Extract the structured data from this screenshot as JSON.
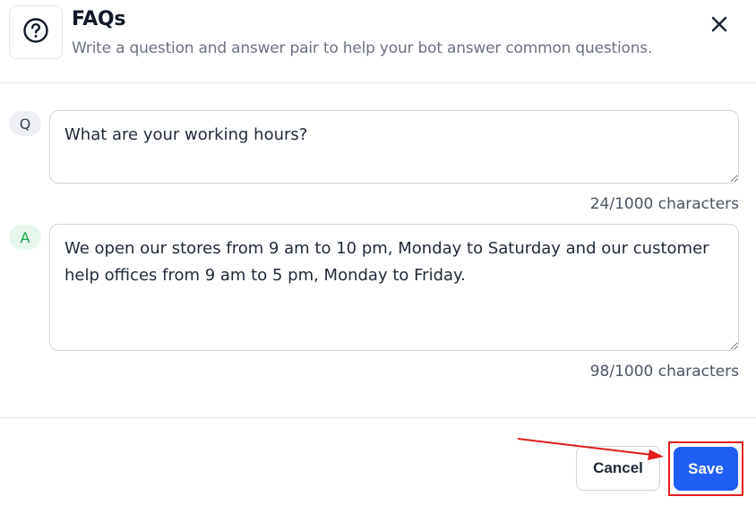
{
  "header": {
    "icon": "question-circle-icon",
    "title": "FAQs",
    "subtitle": "Write a question and answer pair to help your bot answer common questions.",
    "close_icon": "close-icon"
  },
  "faq": {
    "question": {
      "badge": "Q",
      "value": "What are your working hours?",
      "counter": "24/1000 characters"
    },
    "answer": {
      "badge": "A",
      "value": "We open our stores from 9 am to 10 pm, Monday to Saturday and our customer help offices from 9 am to 5 pm, Monday to Friday.",
      "counter": "98/1000 characters"
    }
  },
  "footer": {
    "cancel_label": "Cancel",
    "save_label": "Save"
  },
  "colors": {
    "accent": "#1f5ef5",
    "highlight": "#e11d1d",
    "answer_badge": "#16a34a"
  }
}
